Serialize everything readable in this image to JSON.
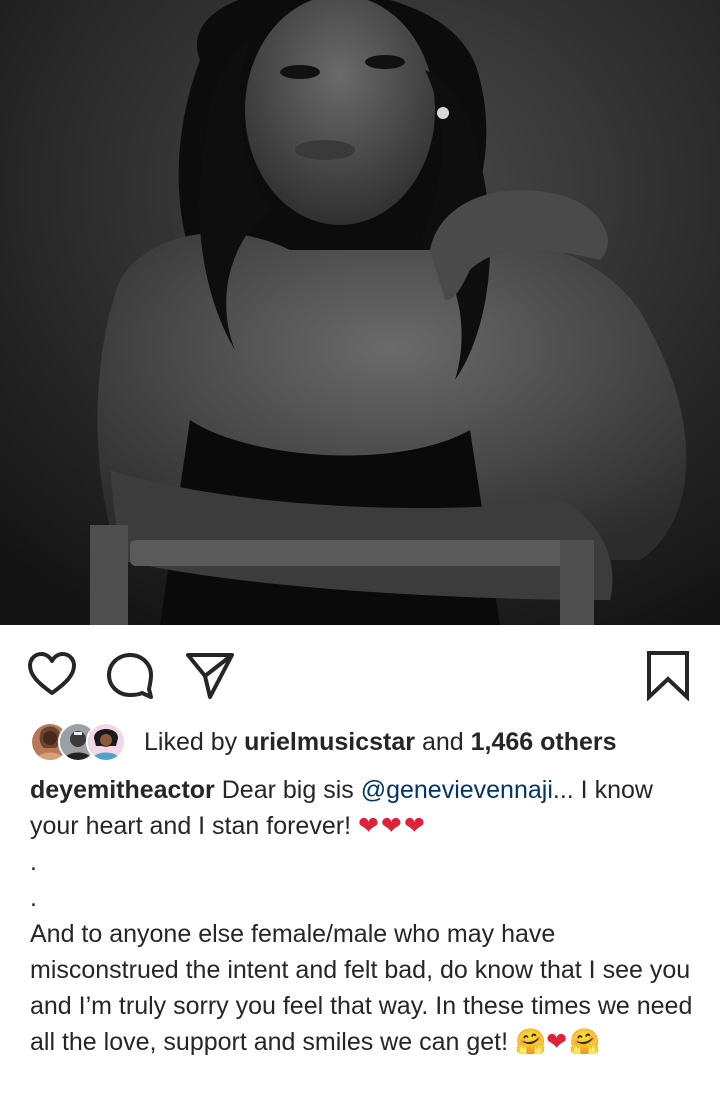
{
  "post": {
    "image_alt": "Black and white portrait photo",
    "liked_by_prefix": "Liked by",
    "liked_by_user": "urielmusicstar",
    "liked_by_middle": "and",
    "liked_by_count": "1,466 others",
    "caption": {
      "username": "deyemitheactor",
      "text_1": "Dear big sis",
      "mention": "@genevievennaji",
      "text_2": "... I know your heart and I stan forever!",
      "hearts_1": "❤❤❤",
      "dot_1": ".",
      "dot_2": ".",
      "paragraph": "And to anyone else female/male who may have misconstrued the intent and felt bad, do know that I see you and I’m truly sorry you feel that way. In these times we need all the love, support and smiles we can get!",
      "end_hug_1": "🤗",
      "end_heart": "❤",
      "end_hug_2": "🤗"
    }
  },
  "icons": {
    "like": "heart-outline-icon",
    "comment": "comment-bubble-icon",
    "share": "paper-plane-icon",
    "save": "bookmark-icon"
  },
  "colors": {
    "text": "#262626",
    "mention": "#003569",
    "heart": "#e0213a"
  }
}
